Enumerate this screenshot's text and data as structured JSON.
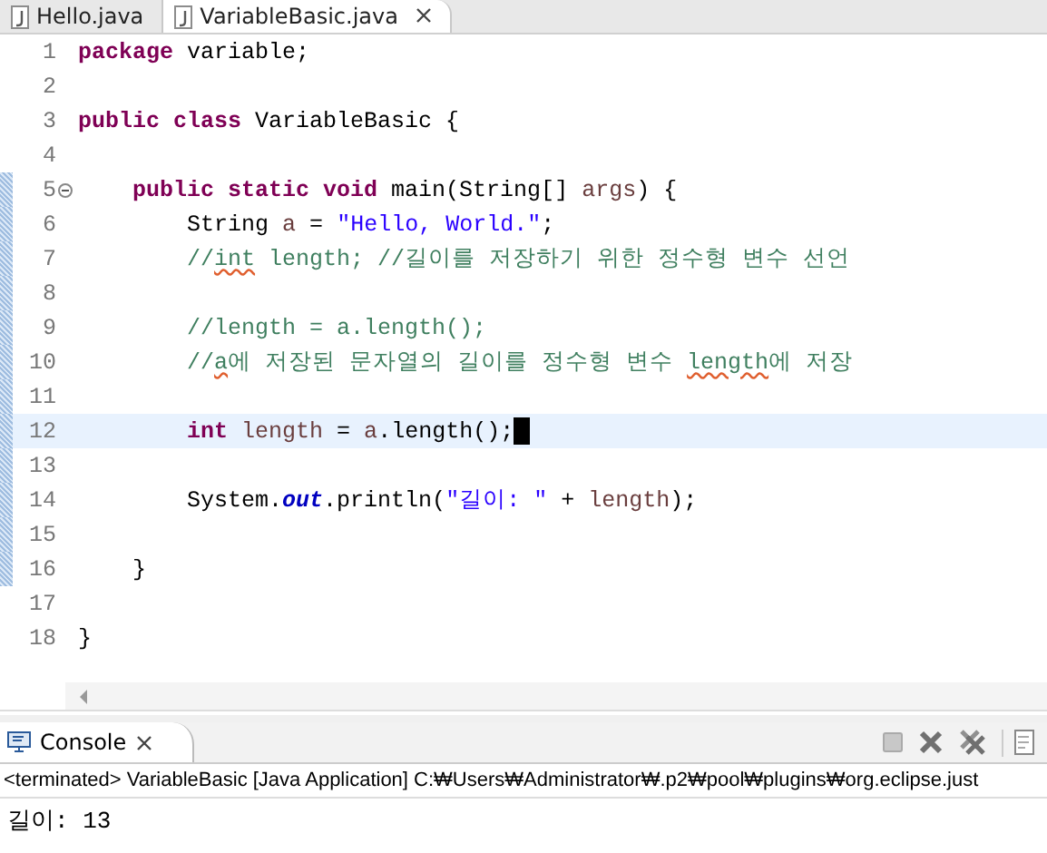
{
  "editor_tabs": [
    {
      "label": "Hello.java",
      "selected": false,
      "closable": false
    },
    {
      "label": "VariableBasic.java",
      "selected": true,
      "closable": true
    }
  ],
  "editor": {
    "lines": [
      {
        "number": "1",
        "current": false,
        "changed": false,
        "fold": false,
        "tokens": [
          {
            "kind": "keyword",
            "text": "package"
          },
          {
            "kind": "plain",
            "text": " variable;"
          }
        ]
      },
      {
        "number": "2",
        "current": false,
        "changed": false,
        "fold": false
      },
      {
        "number": "3",
        "current": false,
        "changed": false,
        "fold": false,
        "tokens": [
          {
            "kind": "keyword",
            "text": "public"
          },
          {
            "kind": "keyword",
            "text": " class"
          },
          {
            "kind": "plain",
            "text": " VariableBasic {"
          }
        ]
      },
      {
        "number": "4",
        "current": false,
        "changed": false,
        "fold": false
      },
      {
        "number": "5",
        "current": false,
        "changed": true,
        "fold": true,
        "tokens": [
          {
            "kind": "keyword",
            "text": "    public"
          },
          {
            "kind": "keyword",
            "text": " static"
          },
          {
            "kind": "keyword",
            "text": " void"
          },
          {
            "kind": "plain",
            "text": " main(String[] "
          },
          {
            "kind": "variable",
            "text": "args"
          },
          {
            "kind": "plain",
            "text": ") {"
          }
        ]
      },
      {
        "number": "6",
        "current": false,
        "changed": true,
        "fold": false,
        "tokens": [
          {
            "kind": "plain",
            "text": "        String "
          },
          {
            "kind": "variable",
            "text": "a"
          },
          {
            "kind": "plain",
            "text": " = "
          },
          {
            "kind": "string",
            "text": "\"Hello, World.\""
          },
          {
            "kind": "plain",
            "text": ";"
          }
        ]
      },
      {
        "number": "7",
        "current": false,
        "changed": true,
        "fold": false,
        "tokens": [
          {
            "kind": "comment",
            "text": "        //"
          },
          {
            "kind": "comment_flagged",
            "text": "int"
          },
          {
            "kind": "comment",
            "text": " length; //길이를 저장하기 위한 정수형 변수 선언"
          }
        ]
      },
      {
        "number": "8",
        "current": false,
        "changed": true,
        "fold": false
      },
      {
        "number": "9",
        "current": false,
        "changed": true,
        "fold": false,
        "tokens": [
          {
            "kind": "comment",
            "text": "        //length = a.length();"
          }
        ]
      },
      {
        "number": "10",
        "current": false,
        "changed": true,
        "fold": false,
        "tokens": [
          {
            "kind": "comment",
            "text": "        //"
          },
          {
            "kind": "comment_flagged",
            "text": "a"
          },
          {
            "kind": "comment",
            "text": "에 저장된 문자열의 길이를 정수형 변수 "
          },
          {
            "kind": "comment_flagged",
            "text": "length"
          },
          {
            "kind": "comment",
            "text": "에 저장"
          }
        ]
      },
      {
        "number": "11",
        "current": false,
        "changed": true,
        "fold": false
      },
      {
        "number": "12",
        "current": true,
        "changed": true,
        "fold": false,
        "tokens": [
          {
            "kind": "keyword",
            "text": "        int"
          },
          {
            "kind": "variable",
            "text": " length"
          },
          {
            "kind": "plain",
            "text": " = "
          },
          {
            "kind": "variable",
            "text": "a"
          },
          {
            "kind": "plain",
            "text": ".length();"
          }
        ]
      },
      {
        "number": "13",
        "current": false,
        "changed": true,
        "fold": false
      },
      {
        "number": "14",
        "current": false,
        "changed": true,
        "fold": false,
        "tokens": [
          {
            "kind": "plain",
            "text": "        System."
          },
          {
            "kind": "field",
            "text": "out"
          },
          {
            "kind": "plain",
            "text": ".println("
          },
          {
            "kind": "string",
            "text": "\"길이: \""
          },
          {
            "kind": "plain",
            "text": " + "
          },
          {
            "kind": "variable",
            "text": "length"
          },
          {
            "kind": "plain",
            "text": ");"
          }
        ]
      },
      {
        "number": "15",
        "current": false,
        "changed": true,
        "fold": false
      },
      {
        "number": "16",
        "current": false,
        "changed": true,
        "fold": false,
        "tokens": [
          {
            "kind": "plain",
            "text": "    }"
          }
        ]
      },
      {
        "number": "17",
        "current": false,
        "changed": false,
        "fold": false
      },
      {
        "number": "18",
        "current": false,
        "changed": false,
        "fold": false,
        "tokens": [
          {
            "kind": "plain",
            "text": "}"
          }
        ]
      }
    ]
  },
  "console": {
    "tab": {
      "label": "Console",
      "selected": true
    },
    "status": "<terminated> VariableBasic [Java Application] C:₩Users₩Administrator₩.p2₩pool₩plugins₩org.eclipse.just",
    "output": "길이: 13"
  }
}
